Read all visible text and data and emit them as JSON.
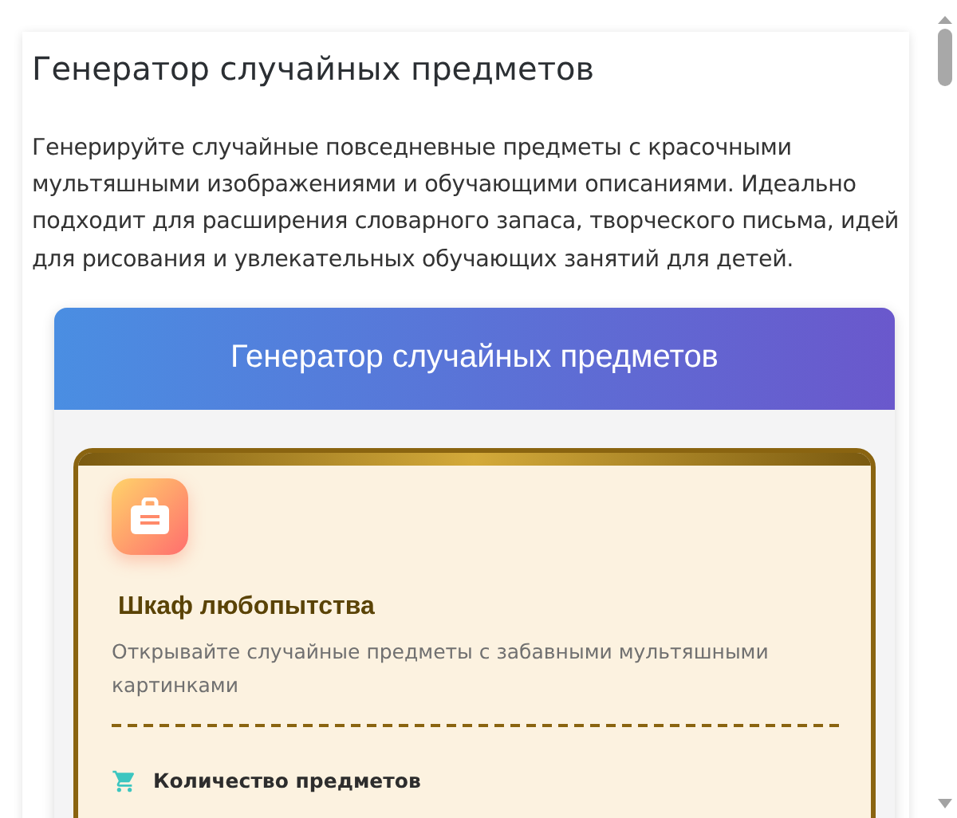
{
  "page": {
    "title": "Генератор случайных предметов",
    "description": "Генерируйте случайные повседневные предметы с красочными мультяшными изображениями и обучающими описаниями. Идеально подходит для расширения словарного запаса, творческого письма, идей для рисования и увлекательных обучающих занятий для детей."
  },
  "widget": {
    "header": "Генератор случайных предметов",
    "card": {
      "title": "Шкаф любопытства",
      "subtitle": "Открывайте случайные предметы с забавными мультяшными картинками"
    },
    "quantity_label": "Количество предметов"
  }
}
